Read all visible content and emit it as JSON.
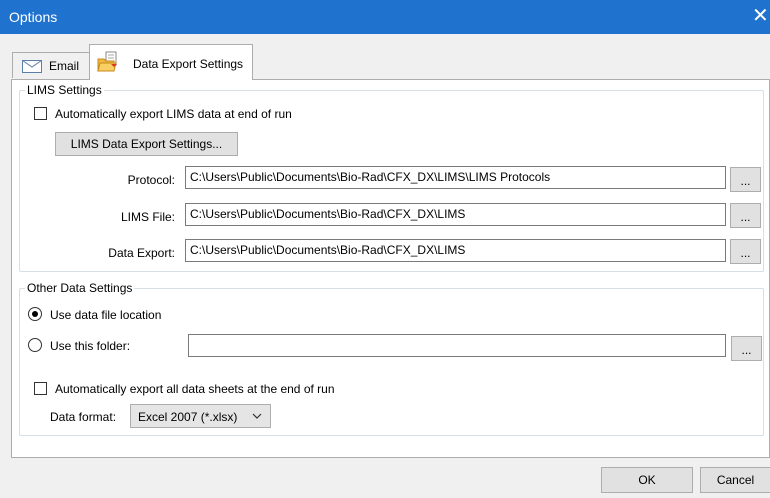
{
  "window": {
    "title": "Options",
    "close_glyph": "✕"
  },
  "tabs": [
    {
      "label": "Email",
      "icon": "envelope-icon"
    },
    {
      "label": "Data Export Settings",
      "icon": "folder-export-icon"
    }
  ],
  "lims": {
    "legend": "LIMS Settings",
    "auto_export_label": "Automatically export LIMS data at end of run",
    "auto_export_checked": false,
    "settings_button": "LIMS Data Export Settings...",
    "protocol_label": "Protocol:",
    "protocol_value": "C:\\Users\\Public\\Documents\\Bio-Rad\\CFX_DX\\LIMS\\LIMS Protocols",
    "lims_file_label": "LIMS File:",
    "lims_file_value": "C:\\Users\\Public\\Documents\\Bio-Rad\\CFX_DX\\LIMS",
    "data_export_label": "Data Export:",
    "data_export_value": "C:\\Users\\Public\\Documents\\Bio-Rad\\CFX_DX\\LIMS",
    "browse_label": "..."
  },
  "other": {
    "legend": "Other Data Settings",
    "use_data_file_label": "Use data file location",
    "use_this_folder_label": "Use this folder:",
    "folder_value": "",
    "auto_export_sheets_label": "Automatically export all data sheets at the end of run",
    "auto_export_sheets_checked": false,
    "data_format_label": "Data format:",
    "data_format_value": "Excel 2007 (*.xlsx)",
    "browse_label": "..."
  },
  "footer": {
    "ok": "OK",
    "cancel": "Cancel"
  },
  "colors": {
    "titlebar": "#1f73cf",
    "panel": "#ffffff",
    "dialog_bg": "#f0f0f0"
  }
}
